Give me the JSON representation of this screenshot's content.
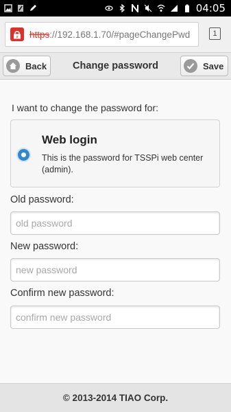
{
  "status_bar": {
    "time": "04:05"
  },
  "browser": {
    "url_scheme": "https",
    "url_rest": "://192.168.1.70/#pageChangePwd",
    "tab_count": "1"
  },
  "header": {
    "back_label": "Back",
    "title": "Change password",
    "save_label": "Save"
  },
  "form": {
    "prompt": "I want to change the password for:",
    "option": {
      "title": "Web login",
      "description": "This is the password for TSSPi web center (admin).",
      "selected": true
    },
    "old_password": {
      "label": "Old password:",
      "placeholder": "old password"
    },
    "new_password": {
      "label": "New password:",
      "placeholder": "new password"
    },
    "confirm_password": {
      "label": "Confirm new password:",
      "placeholder": "confirm new password"
    }
  },
  "footer": {
    "text": "© 2013-2014 TIAO Corp."
  },
  "colors": {
    "accent": "#3388cc",
    "insecure": "#d9342b"
  }
}
